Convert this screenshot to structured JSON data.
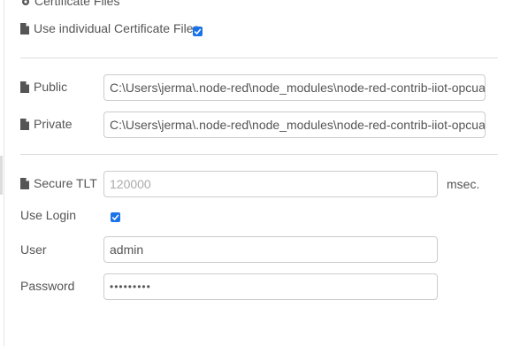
{
  "section": {
    "title": "Certificate Files"
  },
  "use_individual_cert": {
    "label": "Use individual Certificate Files",
    "checked": true
  },
  "public_cert": {
    "label": "Public",
    "value": "C:\\Users\\jerma\\.node-red\\node_modules\\node-red-contrib-iiot-opcua\\certificates"
  },
  "private_cert": {
    "label": "Private",
    "value": "C:\\Users\\jerma\\.node-red\\node_modules\\node-red-contrib-iiot-opcua\\certificates"
  },
  "secure_tlt": {
    "label": "Secure TLT",
    "placeholder": "120000",
    "unit": "msec."
  },
  "use_login": {
    "label": "Use Login",
    "checked": true
  },
  "user": {
    "label": "User",
    "value": "admin"
  },
  "password": {
    "label": "Password",
    "value": "•••••••••"
  },
  "colors": {
    "checkbox": "#1a73e8",
    "label_text": "#555555",
    "placeholder_text": "#aaaaaa",
    "input_border": "#cccccc",
    "divider": "#dddddd"
  },
  "icons": {
    "section": "cog-icon",
    "file": "file-icon"
  }
}
